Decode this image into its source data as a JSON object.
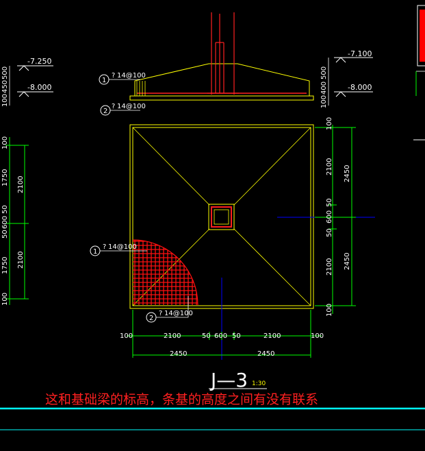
{
  "section": {
    "elev_left_top": "-7.250",
    "elev_left_bottom": "-8.000",
    "elev_right_top": "-7.100",
    "elev_right_bottom": "-8.000",
    "left_dims": [
      "100",
      "450",
      "500"
    ],
    "right_dims": [
      "100",
      "400",
      "500"
    ],
    "rebar_1": "14@100",
    "rebar_2": "14@100",
    "bubble_1": "1",
    "bubble_2": "2"
  },
  "plan": {
    "rebar_1": "14@100",
    "rebar_2": "14@100",
    "bubble_1": "1",
    "bubble_2": "2",
    "bottom_dims": [
      "100",
      "2100",
      "50",
      "600",
      "50",
      "2100",
      "100"
    ],
    "bottom_totals": [
      "2450",
      "2450"
    ],
    "right_dims": [
      "100",
      "2100",
      "50",
      "600",
      "50",
      "2100",
      "100"
    ],
    "right_totals": [
      "2450",
      "2450"
    ],
    "left_dims": [
      "100",
      "1750",
      "50",
      "600",
      "50",
      "1750",
      "100"
    ],
    "left_totals": [
      "2100",
      "2100"
    ]
  },
  "title": {
    "label": "J—3",
    "scale": "1:30"
  },
  "question": "这和基础梁的标高，条基的高度之间有没有联系",
  "colors": {
    "background": "#000000",
    "footing_outline": "#ffff00",
    "rebar": "#ff0000",
    "dimension": "#00ff00",
    "axis": "#0000ff",
    "frame_line": "#00ffff",
    "text": "#ffffff"
  }
}
